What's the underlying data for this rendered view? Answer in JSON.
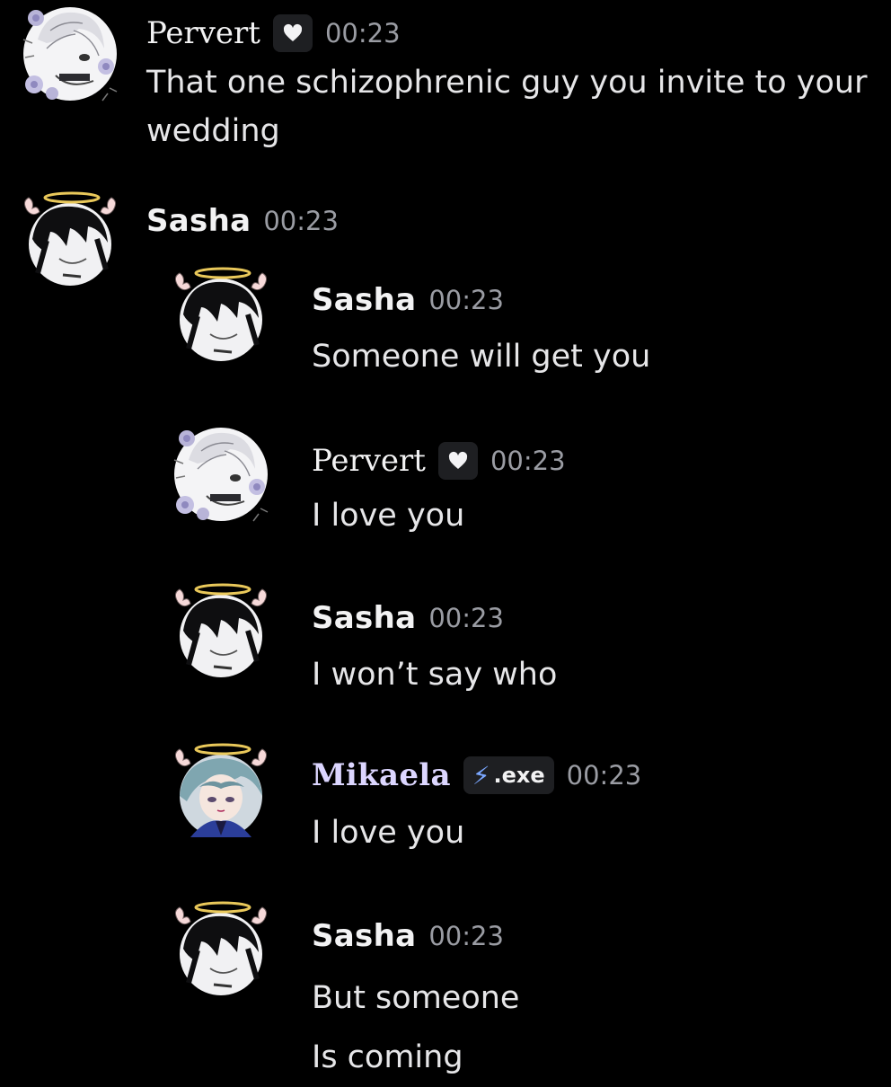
{
  "messages": [
    {
      "author": "Pervert",
      "badge": "heart",
      "timestamp": "00:23",
      "lines": [
        "That one schizophrenic guy you invite to your",
        "wedding"
      ]
    },
    {
      "author": "Sasha",
      "timestamp": "00:23",
      "lines": []
    },
    {
      "author": "Sasha",
      "timestamp": "00:23",
      "lines": [
        "Someone will get you"
      ]
    },
    {
      "author": "Pervert",
      "badge": "heart",
      "timestamp": "00:23",
      "lines": [
        "I love you"
      ]
    },
    {
      "author": "Sasha",
      "timestamp": "00:23",
      "lines": [
        "I won’t say who"
      ]
    },
    {
      "author": "Mikaela",
      "badge_text": ".exe",
      "badge_icon": "lightning-bolt-icon",
      "timestamp": "00:23",
      "lines": [
        "I love you"
      ]
    },
    {
      "author": "Sasha",
      "timestamp": "00:23",
      "lines": [
        "But someone",
        "Is coming"
      ]
    }
  ],
  "colors": {
    "background": "#000000",
    "username": "#f2f2f3",
    "timestamp": "#9a9ca3",
    "badge_bg": "#1e1f22",
    "bolt": "#7aa7ff"
  }
}
